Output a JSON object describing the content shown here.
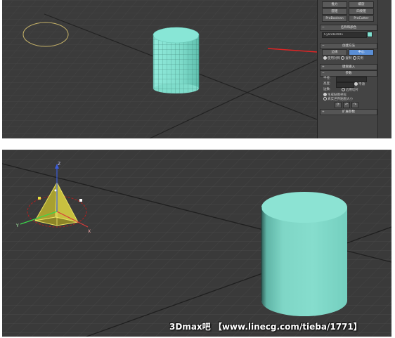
{
  "top_viewport": {
    "command_panel": {
      "row1": [
        "推力",
        "螺旋"
      ],
      "row2": [
        "圆锥",
        "四棱锥"
      ],
      "row3": [
        "ProBoolean",
        "ProCutter"
      ],
      "name_color_header": "名称和颜色",
      "object_name": "Cylinder001",
      "object_color": "#7fe0d0",
      "creation_method_header": "创建方法",
      "creation_modes": [
        "边缘",
        "中心"
      ],
      "creation_modes_row2": [
        "使用对称",
        "复制",
        "实例"
      ],
      "rollout_keyboard": "键盘输入",
      "rollout_params": "参数",
      "radius_label": "半径:",
      "height_label": "高度:",
      "segments_label": "边数:",
      "smooth_label": "平滑",
      "slice_on_label": "启用切片",
      "generate_mapping_label": "生成贴图坐标",
      "real_world_label": "真实世界贴图大小",
      "rollout_extended": "扩展参数",
      "icon_buttons": [
        "⟳",
        "↶",
        "↷"
      ]
    }
  },
  "bottom_viewport": {
    "gizmo_axes": [
      "Z",
      "X",
      "Y"
    ],
    "watermark": "3Dmax吧 【www.linecg.com/tieba/1771】"
  }
}
